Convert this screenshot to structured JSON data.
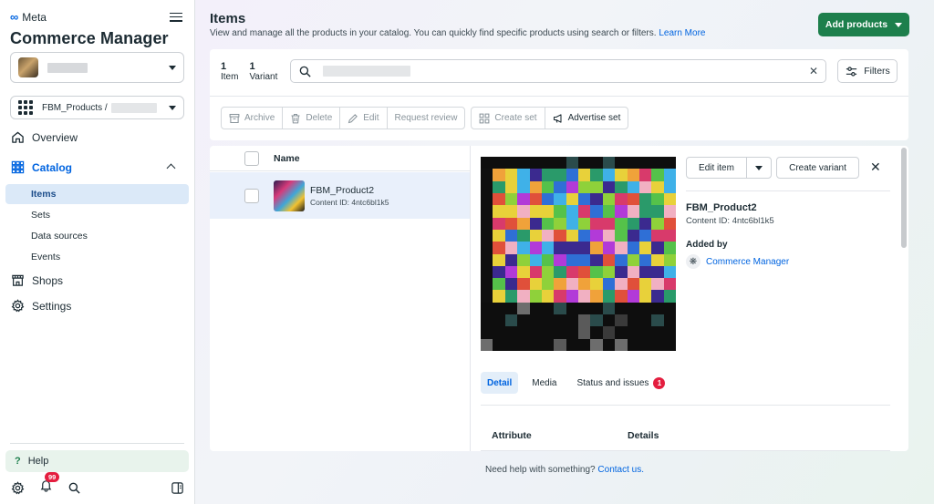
{
  "sidebar": {
    "brand": "Meta",
    "title": "Commerce Manager",
    "catalog_select": "FBM_Products /",
    "nav": {
      "overview": "Overview",
      "catalog": "Catalog",
      "catalog_sub": [
        "Items",
        "Sets",
        "Data sources",
        "Events"
      ],
      "shops": "Shops",
      "settings": "Settings"
    },
    "help": "Help",
    "notifications_count": "99"
  },
  "header": {
    "title": "Items",
    "subtitle": "View and manage all the products in your catalog. You can quickly find specific products using search or filters.",
    "learn_more": "Learn More",
    "add_products": "Add products"
  },
  "summary": {
    "items_count": "1",
    "items_label": "Item",
    "variants_count": "1",
    "variants_label": "Variant"
  },
  "filters_label": "Filters",
  "toolbar": {
    "archive": "Archive",
    "delete": "Delete",
    "edit": "Edit",
    "request_review": "Request review",
    "create_set": "Create set",
    "advertise_set": "Advertise set"
  },
  "list": {
    "header": "Name",
    "rows": [
      {
        "name": "FBM_Product2",
        "content_id": "Content ID: 4ntc6bl1k5"
      }
    ]
  },
  "detail": {
    "edit_item": "Edit item",
    "create_variant": "Create variant",
    "name": "FBM_Product2",
    "content_id": "Content ID: 4ntc6bl1k5",
    "added_by_label": "Added by",
    "added_by_value": "Commerce Manager",
    "tabs": [
      "Detail",
      "Media",
      "Status and issues"
    ],
    "issues_count": "1",
    "table_headers": [
      "Attribute",
      "Details"
    ]
  },
  "footer": {
    "text": "Need help with something?",
    "link": "Contact us."
  }
}
